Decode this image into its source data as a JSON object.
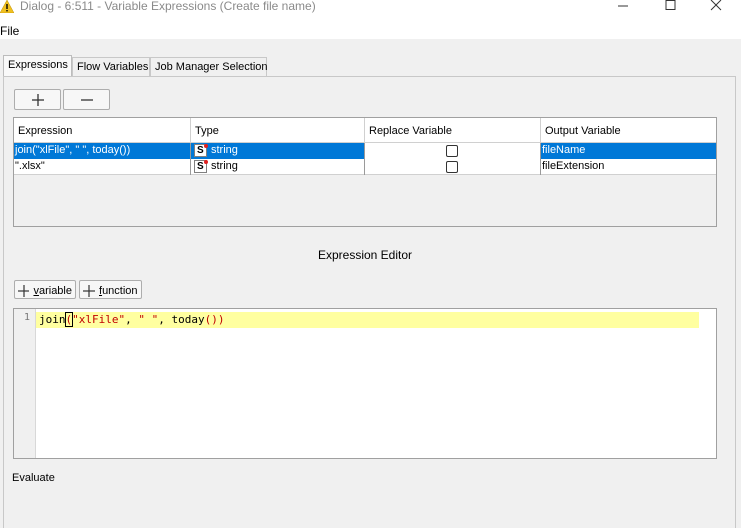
{
  "window": {
    "title": "Dialog - 6:511 - Variable Expressions (Create file name)"
  },
  "menu": {
    "file": "File"
  },
  "tabs": [
    {
      "label": "Expressions"
    },
    {
      "label": "Flow Variables"
    },
    {
      "label": "Job Manager Selection"
    }
  ],
  "table": {
    "columns": [
      "Expression",
      "Type",
      "Replace Variable",
      "Output Variable"
    ],
    "rows": [
      {
        "expression": "join(\"xlFile\", \" \", today())",
        "type_icon": "S",
        "type": "string",
        "replace": false,
        "output": "fileName",
        "selected": true
      },
      {
        "expression": "\".xlsx\"",
        "type_icon": "S",
        "type": "string",
        "replace": false,
        "output": "fileExtension",
        "selected": false
      }
    ]
  },
  "editor": {
    "title": "Expression Editor",
    "variable_button": "variable",
    "function_button": "function",
    "line_number": "1",
    "code": {
      "fn": "join",
      "open": "(",
      "arg1": "\"xlFile\"",
      "sep1": ", ",
      "arg2": "\" \"",
      "sep2": ", ",
      "arg3": "today",
      "inner": "()",
      "close": ")"
    }
  },
  "evaluate_label": "Evaluate",
  "colors": {
    "selection": "#0078d7",
    "highlight_line": "#ffffa0",
    "string_token": "#c00000"
  }
}
